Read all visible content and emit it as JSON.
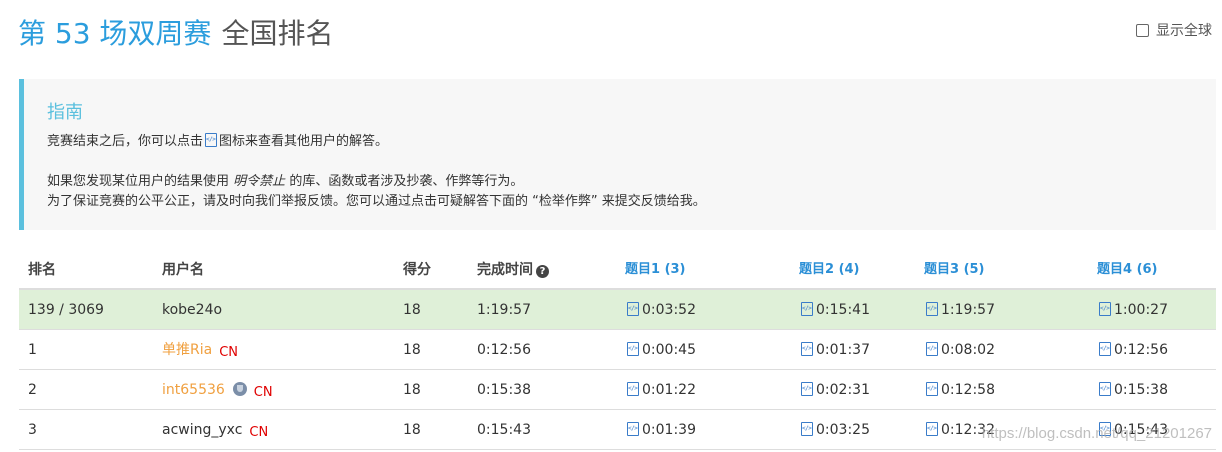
{
  "header": {
    "title_accent": "第 53 场双周赛",
    "title_rest": "全国排名"
  },
  "global_toggle": {
    "label": "显示全球",
    "checked": false
  },
  "guide": {
    "title": "指南",
    "line1_pre": "竞赛结束之后，你可以点击",
    "line1_post": "图标来查看其他用户的解答。",
    "line2_pre": "如果您发现某位用户的结果使用",
    "line2_em": "明令禁止",
    "line2_post": "的库、函数或者涉及抄袭、作弊等行为。",
    "line3": "为了保证竞赛的公平公正，请及时向我们举报反馈。您可以通过点击可疑解答下面的 “检举作弊” 来提交反馈给我。"
  },
  "table": {
    "headers": {
      "rank": "排名",
      "user": "用户名",
      "score": "得分",
      "finish": "完成时间",
      "q1": "题目1 (3)",
      "q2": "题目2 (4)",
      "q3": "题目3 (5)",
      "q4": "题目4 (6)"
    },
    "rows": [
      {
        "rank": "139 / 3069",
        "user": "kobe24o",
        "region": "",
        "score": "18",
        "finish": "1:19:57",
        "q1": "0:03:52",
        "q2": "0:15:41",
        "q3": "1:19:57",
        "q4": "1:00:27"
      },
      {
        "rank": "1",
        "user": "单推Ria",
        "region": "CN",
        "score": "18",
        "finish": "0:12:56",
        "q1": "0:00:45",
        "q2": "0:01:37",
        "q3": "0:08:02",
        "q4": "0:12:56"
      },
      {
        "rank": "2",
        "user": "int65536",
        "region": "CN",
        "score": "18",
        "finish": "0:15:38",
        "q1": "0:01:22",
        "q2": "0:02:31",
        "q3": "0:12:58",
        "q4": "0:15:38"
      },
      {
        "rank": "3",
        "user": "acwing_yxc",
        "region": "CN",
        "score": "18",
        "finish": "0:15:43",
        "q1": "0:01:39",
        "q2": "0:03:25",
        "q3": "0:12:32",
        "q4": "0:15:43"
      }
    ]
  },
  "watermark": "https://blog.csdn.net/qq_21201267",
  "colors": {
    "accent": "#2b9ddd",
    "guide_bar": "#5bc0de",
    "current_user_row": "#dff0d8",
    "top_user": "#f0a040",
    "region": "#e00000"
  },
  "icons": {
    "solution": "code-file-icon",
    "help": "question-circle-icon",
    "badge": "shield-badge-icon"
  }
}
